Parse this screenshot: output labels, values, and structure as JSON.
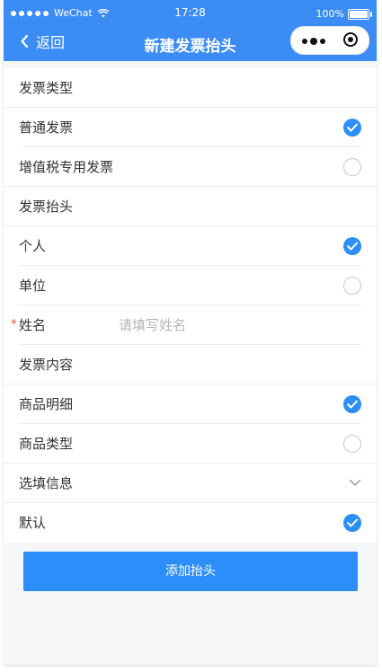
{
  "status_bar": {
    "carrier": "WeChat",
    "time": "17:28",
    "battery_percent": "100%",
    "battery_level": 1.0
  },
  "nav": {
    "back_label": "返回",
    "title": "新建发票抬头"
  },
  "form": {
    "invoice_type": {
      "label": "发票类型",
      "options": [
        {
          "label": "普通发票",
          "selected": true
        },
        {
          "label": "增值税专用发票",
          "selected": false
        }
      ]
    },
    "invoice_header": {
      "label": "发票抬头",
      "options": [
        {
          "label": "个人",
          "selected": true
        },
        {
          "label": "单位",
          "selected": false
        }
      ]
    },
    "name_field": {
      "required_mark": "*",
      "label": "姓名",
      "placeholder": "请填写姓名",
      "value": ""
    },
    "invoice_content": {
      "label": "发票内容",
      "options": [
        {
          "label": "商品明细",
          "selected": true
        },
        {
          "label": "商品类型",
          "selected": false
        }
      ]
    },
    "optional_info": {
      "label": "选填信息"
    },
    "default_toggle": {
      "label": "默认",
      "selected": true
    },
    "submit_label": "添加抬头"
  },
  "colors": {
    "primary": "#3b8df5",
    "check": "#2c8ef8",
    "required": "#e64340"
  }
}
